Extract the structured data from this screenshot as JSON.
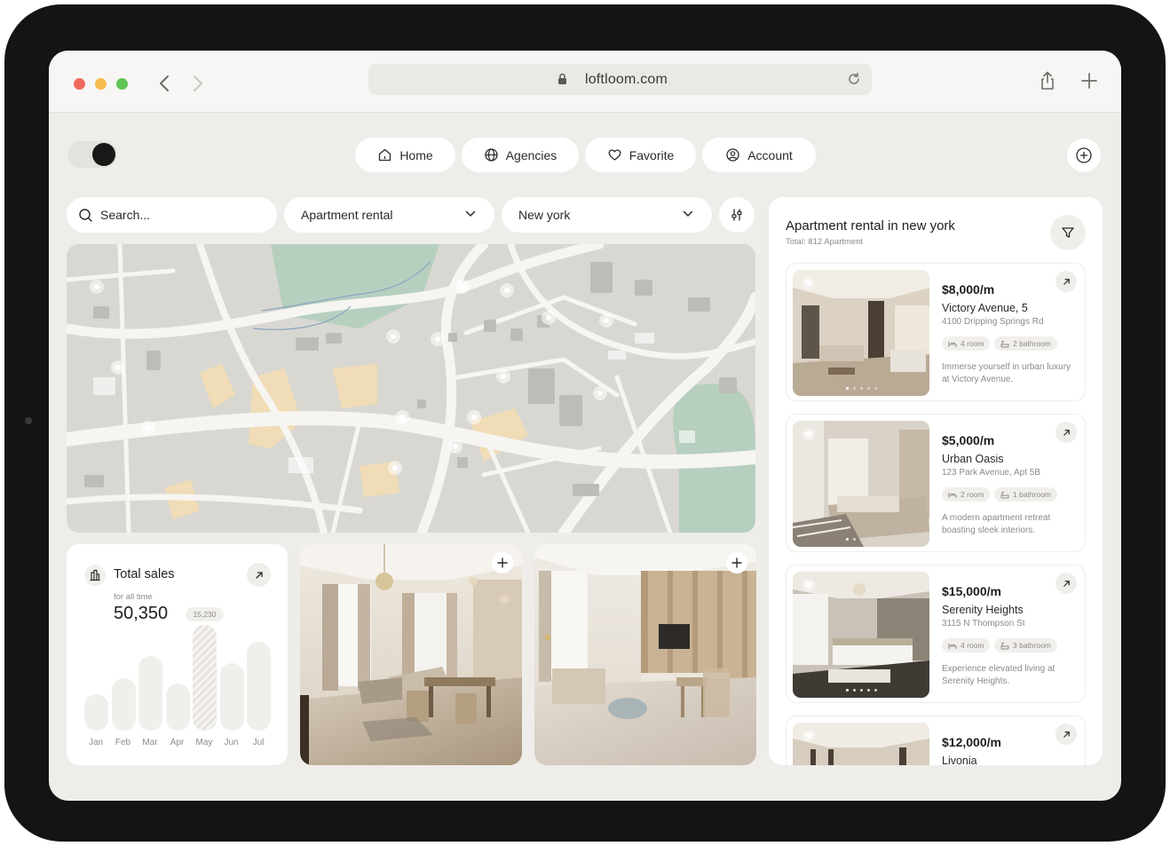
{
  "browser": {
    "url": "loftloom.com"
  },
  "nav": {
    "items": [
      {
        "label": "Home",
        "icon": "home-icon"
      },
      {
        "label": "Agencies",
        "icon": "globe-icon"
      },
      {
        "label": "Favorite",
        "icon": "heart-icon"
      },
      {
        "label": "Account",
        "icon": "user-circle-icon"
      }
    ]
  },
  "search": {
    "placeholder": "Search...",
    "type_value": "Apartment rental",
    "city_value": "New york"
  },
  "sales": {
    "title": "Total sales",
    "subtitle": "for all time",
    "total": "50,350",
    "chart_data": {
      "type": "bar",
      "categories": [
        "Jan",
        "Feb",
        "Mar",
        "Apr",
        "May",
        "Jun",
        "Jul"
      ],
      "values": [
        5200,
        7500,
        10700,
        6800,
        15230,
        9700,
        12800
      ],
      "highlight_index": 4,
      "highlight_label": "15,230"
    }
  },
  "listings": {
    "title": "Apartment rental in new york",
    "subtitle": "Total: 812 Apartment",
    "items": [
      {
        "price": "$8,000/m",
        "title": "Victory Avenue, 5",
        "address": "4100 Dripping Springs Rd",
        "rooms": "4 room",
        "baths": "2 bathroom",
        "desc": "Immerse yourself in urban luxury at Victory Avenue."
      },
      {
        "price": "$5,000/m",
        "title": "Urban Oasis",
        "address": "123 Park Avenue, Apt 5B",
        "rooms": "2 room",
        "baths": "1 bathroom",
        "desc": "A modern apartment retreat boasting sleek interiors."
      },
      {
        "price": "$15,000/m",
        "title": "Serenity Heights",
        "address": "3115 N Thompson St",
        "rooms": "4 room",
        "baths": "3 bathroom",
        "desc": "Experience elevated living at Serenity Heights."
      },
      {
        "price": "$12,000/m",
        "title": "Livonia"
      }
    ]
  },
  "colors": {
    "page": "#efedea",
    "card": "#ffffff",
    "dark": "#1a1817",
    "muted": "#8d8a85",
    "map_green": "#b6cfbf",
    "map_sand": "#f0dcb6"
  }
}
